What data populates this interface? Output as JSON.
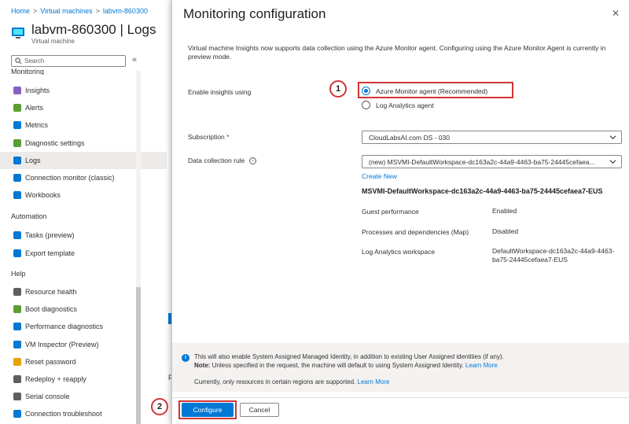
{
  "breadcrumb": [
    "Home",
    "Virtual machines",
    "labvm-860300"
  ],
  "vm": {
    "title": "labvm-860300 | Logs",
    "subtitle": "Virtual machine"
  },
  "search": {
    "placeholder": "Search"
  },
  "sidebar": {
    "section_partial": "Monitoring",
    "items": [
      {
        "label": "Insights",
        "icon": "insights-icon",
        "color": "#8661c5"
      },
      {
        "label": "Alerts",
        "icon": "alerts-icon",
        "color": "#5c9e31"
      },
      {
        "label": "Metrics",
        "icon": "metrics-icon",
        "color": "#0078d4"
      },
      {
        "label": "Diagnostic settings",
        "icon": "diagnostic-settings-icon",
        "color": "#5c9e31"
      },
      {
        "label": "Logs",
        "icon": "logs-icon",
        "color": "#0078d4",
        "selected": true
      },
      {
        "label": "Connection monitor (classic)",
        "icon": "connection-monitor-icon",
        "color": "#0078d4"
      },
      {
        "label": "Workbooks",
        "icon": "workbooks-icon",
        "color": "#0078d4"
      }
    ],
    "automation_title": "Automation",
    "automation_items": [
      {
        "label": "Tasks (preview)",
        "icon": "tasks-icon",
        "color": "#0078d4"
      },
      {
        "label": "Export template",
        "icon": "export-template-icon",
        "color": "#0078d4"
      }
    ],
    "help_title": "Help",
    "help_items": [
      {
        "label": "Resource health",
        "icon": "resource-health-icon",
        "color": "#605e5c"
      },
      {
        "label": "Boot diagnostics",
        "icon": "boot-diagnostics-icon",
        "color": "#5c9e31"
      },
      {
        "label": "Performance diagnostics",
        "icon": "performance-diagnostics-icon",
        "color": "#0078d4"
      },
      {
        "label": "VM Inspector (Preview)",
        "icon": "vm-inspector-icon",
        "color": "#0078d4"
      },
      {
        "label": "Reset password",
        "icon": "reset-password-icon",
        "color": "#e8a200"
      },
      {
        "label": "Redeploy + reapply",
        "icon": "redeploy-icon",
        "color": "#605e5c"
      },
      {
        "label": "Serial console",
        "icon": "serial-console-icon",
        "color": "#605e5c"
      },
      {
        "label": "Connection troubleshoot",
        "icon": "connection-troubleshoot-icon",
        "color": "#0078d4"
      }
    ],
    "background_letter": "F"
  },
  "blade": {
    "title": "Monitoring configuration",
    "intro": "Virtual machine Insights now supports data collection using the Azure Monitor agent. Configuring using the Azure Monitor Agent is currently in preview mode.",
    "enable_label": "Enable insights using",
    "radio_ama": "Azure Monitor agent (Recommended)",
    "radio_la": "Log Analytics agent",
    "subscription_label": "Subscription",
    "required_mark": "*",
    "subscription_value": "CloudLabsAI.com DS - 030",
    "dcr_label": "Data collection rule",
    "dcr_value": "(new) MSVMI-DefaultWorkspace-dc163a2c-44a9-4463-ba75-24445cefaea...",
    "create_new": "Create New",
    "dcr_name": "MSVMI-DefaultWorkspace-dc163a2c-44a9-4463-ba75-24445cefaea7-EUS",
    "props": [
      {
        "label": "Guest performance",
        "value": "Enabled"
      },
      {
        "label": "Processes and dependencies (Map)",
        "value": "Disabled"
      },
      {
        "label": "Log Analytics workspace",
        "value_line1": "DefaultWorkspace-dc163a2c-44a9-4463-",
        "value_line2": "ba75-24445cefaea7-EUS"
      }
    ],
    "notice": {
      "line1": "This will also enable System Assigned Managed Identity, in addition to existing User Assigned identities (if any).",
      "note_bold": "Note:",
      "line2": " Unless specified in the request, the machine will default to using System Assigned Identity. ",
      "learn_more_1": "Learn More",
      "line3": "Currently, only resources in certain regions are supported. ",
      "learn_more_2": "Learn More"
    },
    "configure_label": "Configure",
    "cancel_label": "Cancel"
  },
  "annotations": {
    "step1": "1",
    "step2": "2",
    "highlight_color": "#d13438"
  }
}
